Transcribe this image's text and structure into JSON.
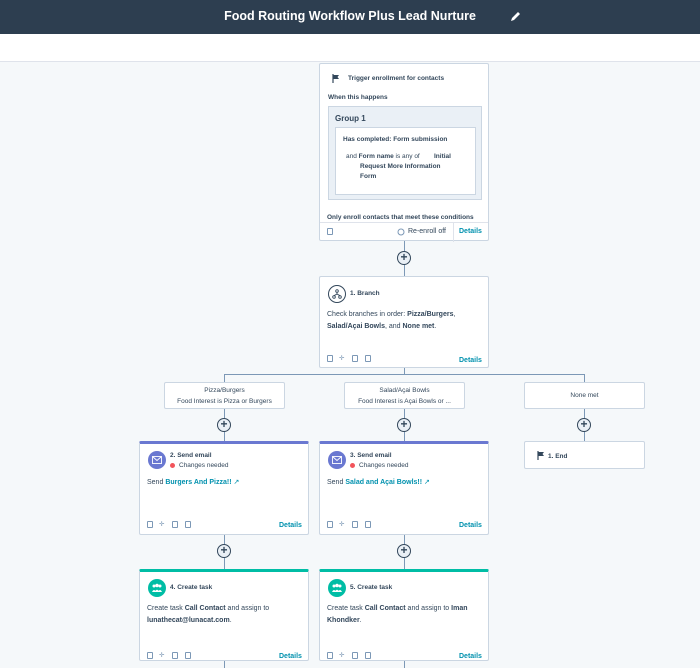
{
  "header": {
    "title": "Food Routing Workflow Plus Lead Nurture"
  },
  "trigger": {
    "title": "Trigger enrollment for contacts",
    "when": "When this happens",
    "group_title": "Group 1",
    "has_completed": "Has completed: Form submission",
    "cond_and": "and",
    "cond_field": "Form name",
    "cond_op": "is any of",
    "cond_value": "Initial Request More Information Form",
    "only_enroll": "Only enroll contacts that meet these conditions",
    "reenroll": "Re-enroll off",
    "details": "Details"
  },
  "branch": {
    "title": "1. Branch",
    "text_prefix": "Check branches in order:",
    "b1": "Pizza/Burgers",
    "b2": "Salad/Açai Bowls",
    "and": "and",
    "b3": "None met",
    "details": "Details"
  },
  "branches": [
    {
      "name": "Pizza/Burgers",
      "desc": "Food Interest is Pizza or Burgers"
    },
    {
      "name": "Salad/Açai Bowls",
      "desc": "Food Interest is Açai Bowls or ..."
    },
    {
      "name": "None met",
      "desc": ""
    }
  ],
  "email1": {
    "title": "2. Send email",
    "status": "Changes needed",
    "send": "Send",
    "link": "Burgers And Pizza!!",
    "details": "Details"
  },
  "email2": {
    "title": "3. Send email",
    "status": "Changes needed",
    "send": "Send",
    "link": "Salad and Açai Bowls!!",
    "details": "Details"
  },
  "end": {
    "title": "1. End"
  },
  "task1": {
    "title": "4. Create task",
    "p1": "Create task",
    "task": "Call Contact",
    "p2": "and assign to",
    "assignee": "lunathecat@lunacat.com",
    "details": "Details"
  },
  "task2": {
    "title": "5. Create task",
    "p1": "Create task",
    "task": "Call Contact",
    "p2": "and assign to",
    "assignee": "Iman Khondker",
    "details": "Details"
  },
  "colors": {
    "header": "#2d3e50",
    "email_accent": "#6a78d1",
    "task_accent": "#00bda5",
    "link": "#0091ae"
  }
}
